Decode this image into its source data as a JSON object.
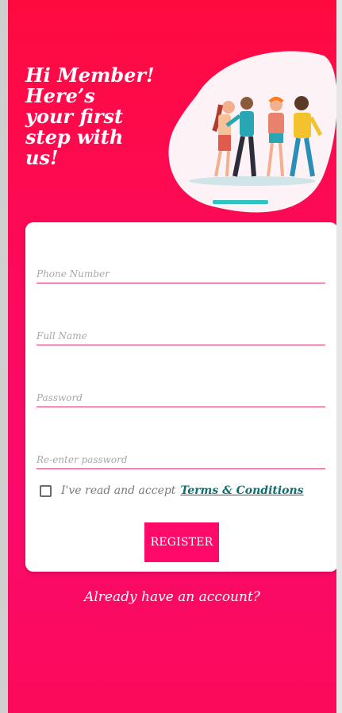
{
  "header": {
    "greeting": "Hi Member!\nHere’s\nyour first\nstep with\nus!",
    "illustration_icon": "people-group-illustration"
  },
  "form": {
    "phone": {
      "placeholder": "Phone Number",
      "value": ""
    },
    "full_name": {
      "placeholder": "Full Name",
      "value": ""
    },
    "password": {
      "placeholder": "Password",
      "value": ""
    },
    "re_password": {
      "placeholder": "Re-enter password",
      "value": ""
    },
    "terms": {
      "checked": false,
      "text": "I've read and accept",
      "link": "Terms & Conditions"
    },
    "register_label": "REGISTER"
  },
  "footer": {
    "already_label": "Already have an account?"
  },
  "colors": {
    "primary": "#ff0a6b",
    "accent_teal": "#0f6e6e",
    "underline": "#e03a62"
  }
}
